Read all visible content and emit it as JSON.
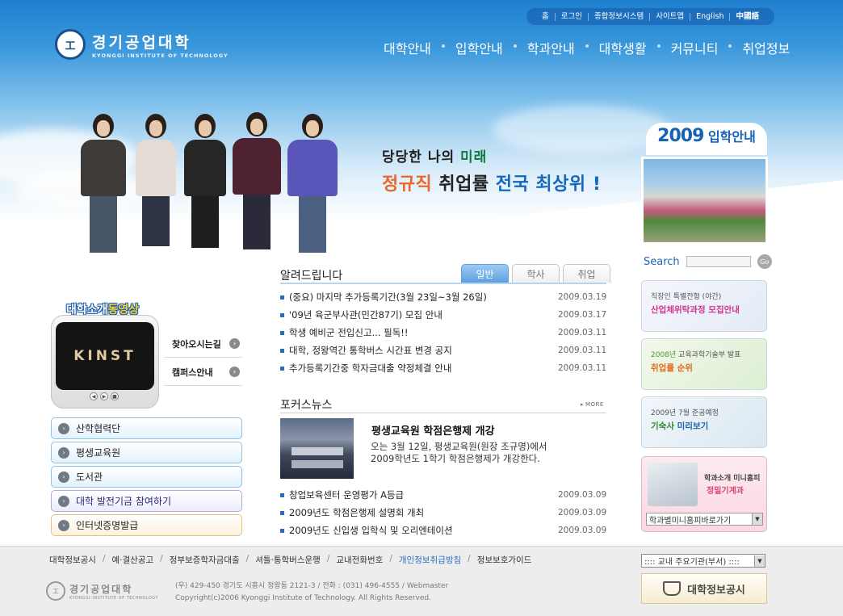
{
  "logo": {
    "seal": "工",
    "name_ko": "경기공업대학",
    "name_en": "KYONGGI INSTITUTE OF TECHNOLOGY"
  },
  "util_nav": [
    "홈",
    "로그인",
    "종합정보시스템",
    "사이트맵",
    "English",
    "中國語"
  ],
  "gnb": [
    "대학안내",
    "입학안내",
    "학과안내",
    "대학생활",
    "커뮤니티",
    "취업정보"
  ],
  "slogan": {
    "line1_a": "당당한 ",
    "line1_b": "나의 ",
    "line1_c": "미래",
    "line2_a": "정규직",
    "line2_b": " 취업률 ",
    "line2_c": "전국 최상위",
    "line2_d": " !"
  },
  "admission": {
    "year": "2009",
    "label": "입학안내"
  },
  "search": {
    "label": "Search",
    "placeholder": "",
    "go": "Go"
  },
  "promo_video": {
    "title_a": "대학소개",
    "title_b": "동영상",
    "screen_text": "KINST",
    "controls": [
      "◀",
      "▶",
      "■"
    ]
  },
  "video_links": [
    "찾아오시는길",
    "캠퍼스안내"
  ],
  "quick_links": [
    "산학협력단",
    "평생교육원",
    "도서관",
    "대학 발전기금 참여하기",
    "인터넷증명발급"
  ],
  "notice": {
    "title": "알려드립니다",
    "tabs": [
      "일반",
      "학사",
      "취업"
    ],
    "active_tab": "일반",
    "items": [
      {
        "title": "(중요) 마지막 추가등록기간(3월 23일~3월 26일)",
        "date": "2009.03.19"
      },
      {
        "title": "'09년 육군부사관(민간87기) 모집 안내",
        "date": "2009.03.17"
      },
      {
        "title": "학생 예비군 전입신고... 필독!!",
        "date": "2009.03.11"
      },
      {
        "title": "대학, 정왕역간 통학버스 시간표 변경 공지",
        "date": "2009.03.11"
      },
      {
        "title": "추가등록기간중 학자금대출 약정체결 안내",
        "date": "2009.03.11"
      }
    ]
  },
  "focus_news": {
    "title": "포커스뉴스",
    "more": "MORE",
    "headline": "평생교육원 학점은행제 개강",
    "summary_line1": "오는 3월 12일, 평생교육원(원장 조규명)에서",
    "summary_line2": "2009학년도 1학기 학점은행제가 개강한다.",
    "items": [
      {
        "title": "창업보육센터 운영평가 A등급",
        "date": "2009.03.09"
      },
      {
        "title": "2009년도 학점은행제 설명회 개최",
        "date": "2009.03.09"
      },
      {
        "title": "2009년도 신입생 입학식 및 오리엔테이션",
        "date": "2009.03.09"
      }
    ]
  },
  "right_banners": [
    {
      "small": "직장인 특별전형 (야간)",
      "main_a": "산업체위탁과정",
      "main_b": " 모집안내"
    },
    {
      "small_a": "2008년",
      "small_b": " 교육과학기술부 발표",
      "main_a": "취업률 순위",
      "main_b": ""
    },
    {
      "small": "2009년 7월 준공예정",
      "main_a": "기숙사",
      "main_b": " 미리보기"
    }
  ],
  "mini_homepage": {
    "line1": "학과소개 미니홈피",
    "line2": "정밀기계과",
    "select": "학과별미니홈피바로가기"
  },
  "footer": {
    "links": [
      "대학정보공시",
      "예·결산공고",
      "정부보증학자금대출",
      "셔틀·통학버스운행",
      "교내전화번호",
      "개인정보취급방침",
      "정보보호가이드"
    ],
    "address": "(우) 429-450  경기도 시흥시 정왕동 2121-3  /  전화 : (031) 496-4555  /  Webmaster",
    "copyright": "Copyright(c)2006 Kyonggi Institute of Technology. All Rights Reserved.",
    "org_select": ":::: 교내 주요기관(부서) ::::",
    "info_banner": "대학정보공시",
    "logo_ko": "경기공업대학",
    "logo_en": "KYONGGI INSTITUTE OF TECHNOLOGY"
  },
  "colors": {
    "brand_blue": "#1a64b4",
    "sky_top": "#1e7fcf",
    "accent_orange": "#e8682a",
    "tab_active": "#5d9fdf"
  }
}
